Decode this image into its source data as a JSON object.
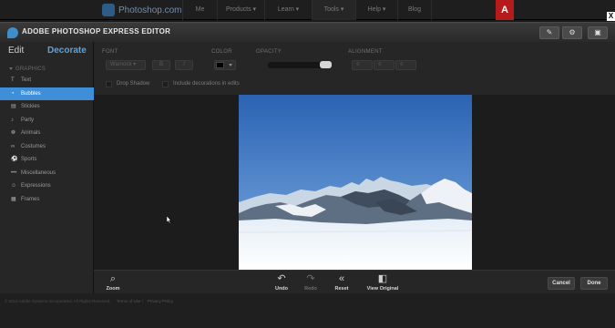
{
  "site_nav": {
    "logo_text": "Photoshop.com",
    "items": [
      "Me",
      "Products ▾",
      "Learn ▾",
      "Tools ▾",
      "Help ▾",
      "Blog"
    ],
    "active_item": "Tools ▾",
    "adobe_label": "A"
  },
  "close_label": "X",
  "editor": {
    "title": "ADOBE PHOTOSHOP EXPRESS EDITOR"
  },
  "left_panel": {
    "tabs": [
      "Edit",
      "Decorate"
    ],
    "active_tab": "Decorate",
    "section": "GRAPHICS",
    "items": [
      {
        "label": "Text",
        "icon": "text-icon"
      },
      {
        "label": "Bubbles",
        "icon": "speech-bubble-icon",
        "selected": true
      },
      {
        "label": "Stickies",
        "icon": "sticky-note-icon"
      },
      {
        "label": "Party",
        "icon": "party-icon"
      },
      {
        "label": "Animals",
        "icon": "paw-icon"
      },
      {
        "label": "Costumes",
        "icon": "mask-icon"
      },
      {
        "label": "Sports",
        "icon": "ball-icon"
      },
      {
        "label": "Miscellaneous",
        "icon": "dots-icon"
      },
      {
        "label": "Expressions",
        "icon": "expressions-icon"
      },
      {
        "label": "Frames",
        "icon": "frame-icon"
      }
    ]
  },
  "options": {
    "font_label": "FONT",
    "font_value": "Warnock ▾",
    "bold_label": "B",
    "italic_label": "I",
    "color_label": "COLOR",
    "opacity_label": "OPACITY",
    "opacity_value": 1.0,
    "alignment_label": "ALIGNMENT",
    "drop_shadow_label": "Drop Shadow",
    "include_decorations_label": "Include decorations in edits"
  },
  "bottom_bar": {
    "zoom": "Zoom",
    "undo": "Undo",
    "redo": "Redo",
    "reset": "Reset",
    "view_original": "View Original",
    "cancel": "Cancel",
    "done": "Done"
  },
  "footer": {
    "copyright": "© 2013 Adobe Systems Incorporated. All Rights Reserved.",
    "terms": "Terms of Use",
    "privacy": "Privacy Policy"
  },
  "colors": {
    "accent": "#3e8fd8",
    "decorate_tab": "#5ba2e0",
    "adobe_red": "#b51b1b",
    "panel_bg": "#262626"
  }
}
